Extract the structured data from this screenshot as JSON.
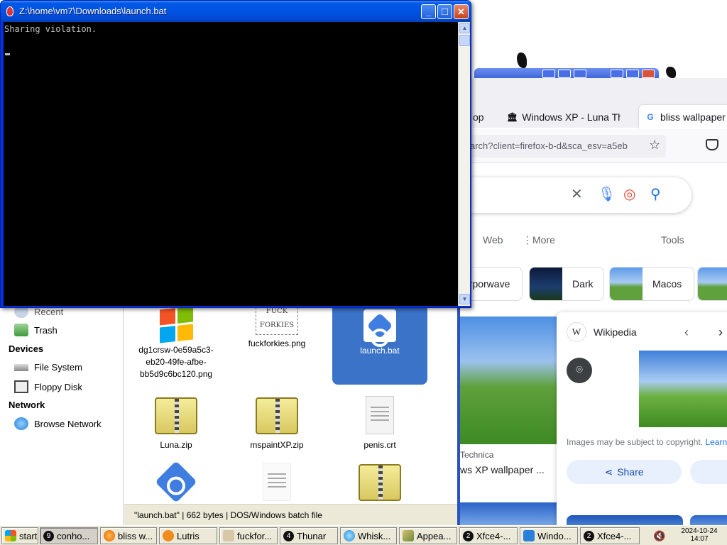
{
  "console": {
    "title": "Z:\\home\\vm7\\Downloads\\launch.bat",
    "output": "Sharing violation.",
    "buttons": {
      "minimize": "_",
      "maximize": "□",
      "close": "✕"
    }
  },
  "browser": {
    "tabs": [
      {
        "label": "op",
        "favicon": "partial-tab"
      },
      {
        "label": "Windows XP - Luna Th",
        "favicon": "building-icon"
      },
      {
        "label": "bliss wallpaper -",
        "favicon": "google-g-icon"
      }
    ],
    "url": "arch?client=firefox-b-d&sca_esv=a5eb",
    "filters": {
      "web": "Web",
      "more": "More",
      "tools": "Tools"
    },
    "chips": [
      "orporwave",
      "Dark",
      "Macos"
    ],
    "result_left": {
      "source": "Technica",
      "title": "ws XP wallpaper ..."
    },
    "panel": {
      "source": "Wikipedia",
      "wiki_logo": "W",
      "copyright": "Images may be subject to copyright.",
      "copyright_link": "Learn",
      "share": "Share"
    }
  },
  "thunar": {
    "sidebar": {
      "recent": "Recent",
      "trash": "Trash",
      "devices_head": "Devices",
      "filesystem": "File System",
      "floppy": "Floppy Disk",
      "network_head": "Network",
      "browse_network": "Browse Network"
    },
    "files": [
      {
        "name": "dg1crsw-0e59a5c3-eb20-49fe-afbe-bb5d9c6bc120.png",
        "icon": "windows-logo"
      },
      {
        "name": "fuckforkies.png",
        "icon": "sketch-image",
        "sketch_text": "FUCK FORKIES"
      },
      {
        "name": "launch.bat",
        "icon": "batch-file",
        "selected": true
      },
      {
        "name": "Luna.zip",
        "icon": "zip-archive"
      },
      {
        "name": "mspaintXP.zip",
        "icon": "zip-archive"
      },
      {
        "name": "penis.crt",
        "icon": "certificate-doc"
      }
    ],
    "status": {
      "name": "\"launch.bat\"",
      "size": "662 bytes",
      "type": "DOS/Windows batch file"
    }
  },
  "taskbar": {
    "start": "start",
    "items": [
      {
        "label": "conho...",
        "badge": "9",
        "icon": "console-icon"
      },
      {
        "label": "bliss w...",
        "badge": "",
        "icon": "firefox-icon"
      },
      {
        "label": "Lutris",
        "badge": "",
        "icon": "lutris-icon"
      },
      {
        "label": "fuckfor...",
        "badge": "",
        "icon": "image-icon"
      },
      {
        "label": "Thunar",
        "badge": "4",
        "icon": "folder-icon"
      },
      {
        "label": "Whisk...",
        "badge": "",
        "icon": "whisker-icon"
      },
      {
        "label": "Appea...",
        "badge": "",
        "icon": "appearance-icon"
      },
      {
        "label": "Xfce4-...",
        "badge": "2",
        "icon": "terminal-icon"
      },
      {
        "label": "Windo...",
        "badge": "",
        "icon": "window-icon"
      },
      {
        "label": "Xfce4-...",
        "badge": "2",
        "icon": "terminal-icon"
      }
    ],
    "clock_date": "2024-10-24",
    "clock_time": "14:07"
  },
  "colors": {
    "xp_blue": "#0054e3",
    "selection": "#3b73c9",
    "taskbar": "#ece9d8"
  }
}
